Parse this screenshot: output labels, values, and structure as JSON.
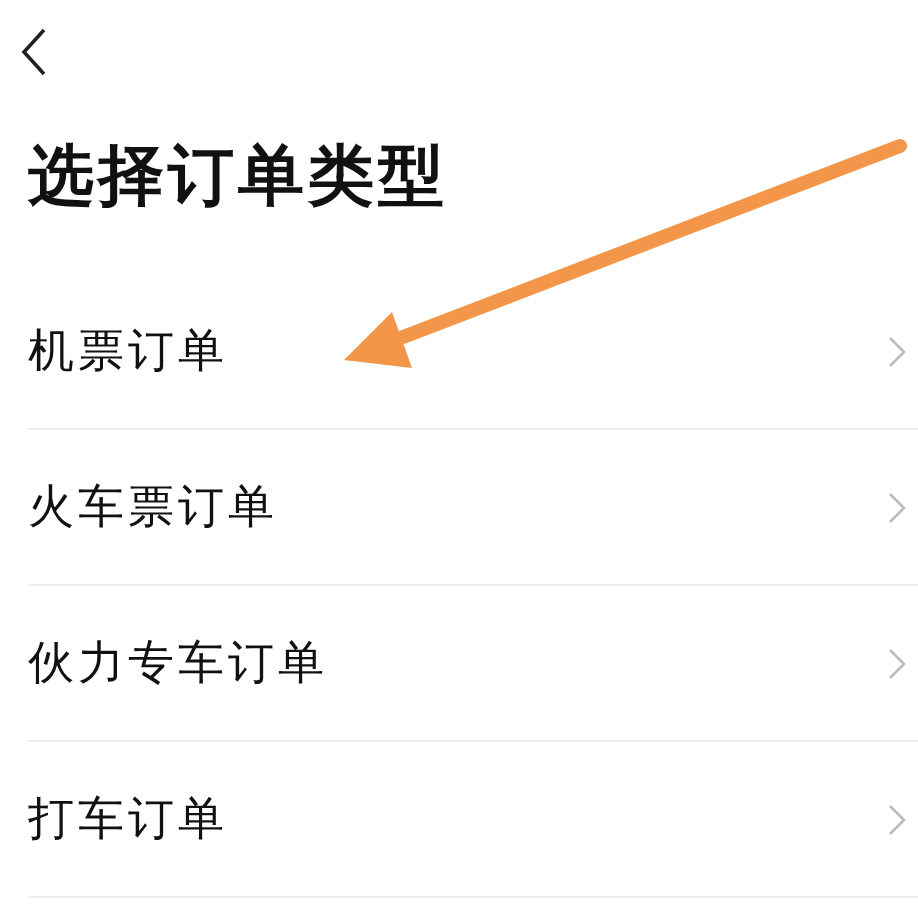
{
  "title": "选择订单类型",
  "items": [
    {
      "label": "机票订单"
    },
    {
      "label": "火车票订单"
    },
    {
      "label": "伙力专车订单"
    },
    {
      "label": "打车订单"
    }
  ],
  "annotation": {
    "kind": "arrow"
  }
}
